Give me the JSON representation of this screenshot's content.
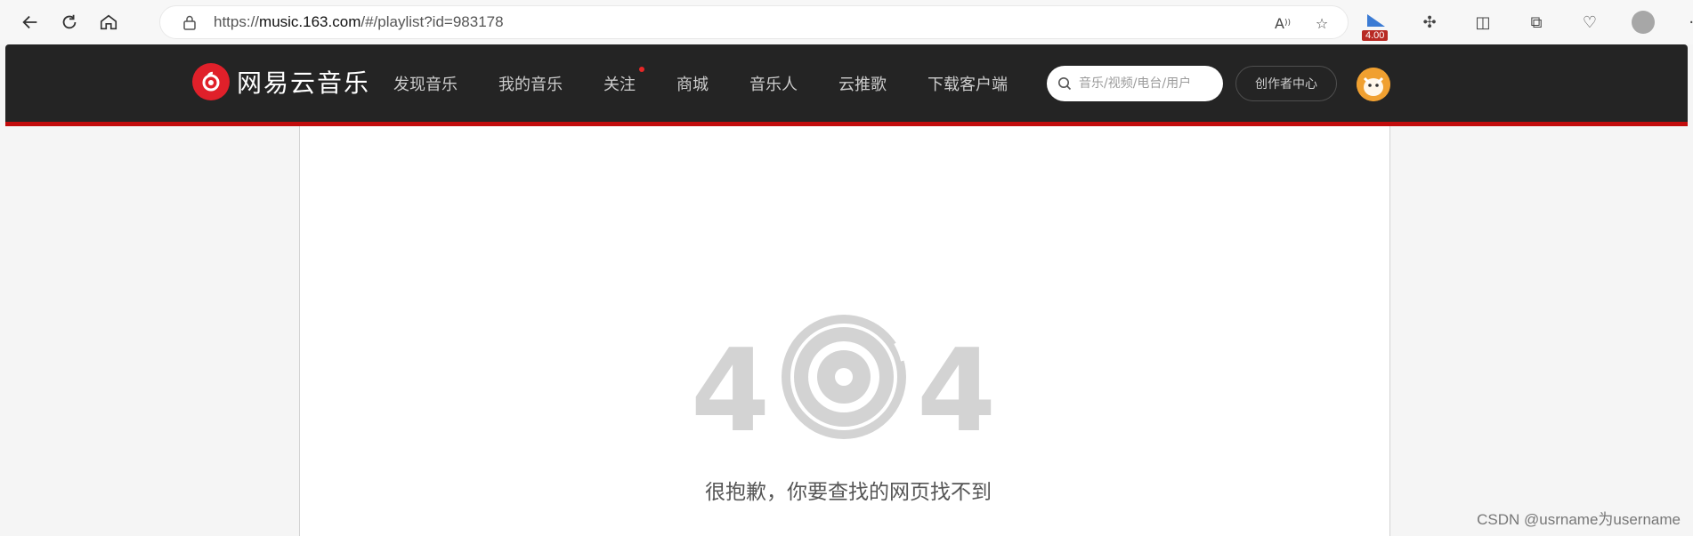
{
  "browser": {
    "url_prefix": "https://",
    "url_host": "music.163.com",
    "url_path": "/#/playlist?id=983178",
    "ext_badge": "4.00"
  },
  "site": {
    "logo_text": "网易云音乐",
    "nav": [
      "发现音乐",
      "我的音乐",
      "关注",
      "商城",
      "音乐人",
      "云推歌",
      "下载客户端"
    ],
    "search_placeholder": "音乐/视频/电台/用户",
    "creator_label": "创作者中心"
  },
  "error": {
    "code_left": "4",
    "code_right": "4",
    "message": "很抱歉，你要查找的网页找不到"
  },
  "watermark": "CSDN @usrname为username",
  "colors": {
    "header_bg": "#242424",
    "accent_red": "#c20c0c",
    "error_gray": "#d3d3d3"
  }
}
